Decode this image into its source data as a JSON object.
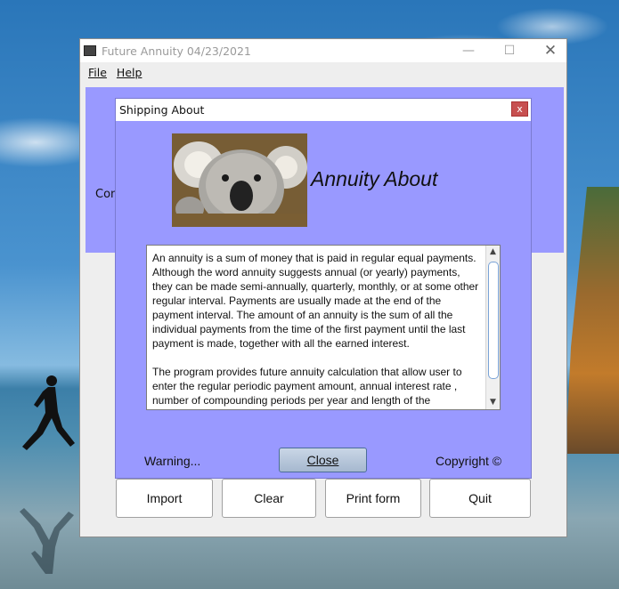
{
  "app": {
    "title": "Future Annuity 04/23/2021",
    "controls": {
      "minimize": "—",
      "maximize": "☐",
      "close": "✕"
    },
    "menu": [
      {
        "label": "File"
      },
      {
        "label": "Help"
      }
    ],
    "panel_label": "Com",
    "buttons": {
      "import": "Import",
      "clear": "Clear",
      "print": "Print form",
      "quit": "Quit"
    },
    "panel_color": "#9999ff"
  },
  "dialog": {
    "title": "Shipping About",
    "close_glyph": "x",
    "heading": "Annuity About",
    "body": [
      "An annuity is a sum of money that is paid in regular equal payments. Although the word annuity suggests annual (or yearly) payments, they can be made semi-annually, quarterly, monthly, or at some other regular interval. Payments are usually made at the end of the payment interval. The amount of an annuity is the sum of all the individual payments from the time of the first payment until the last payment is made, together with all the earned interest.",
      "The program provides future annuity calculation that allow user to enter the regular periodic payment amount, annual interest rate , number of compounding periods per year and length of the"
    ],
    "warning": "Warning...",
    "close_button": "Close",
    "copyright": "Copyright ©",
    "image": "koala-photo"
  }
}
